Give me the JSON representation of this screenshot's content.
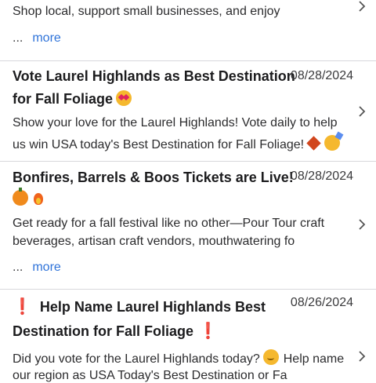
{
  "items": [
    {
      "body_line1": "Shop local, support small businesses, and enjoy",
      "more_dots": "...",
      "more_label": "more"
    },
    {
      "title_line1": "Vote Laurel Highlands as Best Destination",
      "title_line2": "for Fall Foliage",
      "date": "08/28/2024",
      "body_line1": "Show your love for the Laurel Highlands! Vote daily to help",
      "body_line2": "us win USA today's Best Destination for Fall Foliage!"
    },
    {
      "title_line1": "Bonfires, Barrels & Boos Tickets are Live!",
      "date": "08/28/2024",
      "body_line1": "Get ready for a fall festival like no other—Pour Tour craft",
      "body_line2": "beverages, artisan craft vendors, mouthwatering fo",
      "more_dots": "...",
      "more_label": "more"
    },
    {
      "title_line1": "Help Name Laurel Highlands Best",
      "title_line2": "Destination for Fall Foliage",
      "date": "08/26/2024",
      "body_line1_a": "Did you vote for the Laurel Highlands today?",
      "body_line1_b": "Help name",
      "body_line2": "our region as USA Today's Best Destination or Fa"
    }
  ],
  "icons": {
    "chevron": "chevron-right-icon",
    "emoji": [
      "heart-eyes-emoji",
      "maple-leaf-emoji",
      "partying-face-emoji",
      "jack-o-lantern-emoji",
      "fire-emoji",
      "thinking-face-emoji",
      "exclamation-emoji"
    ]
  },
  "colors": {
    "link": "#2f73d9",
    "divider": "#d8d8dc",
    "exclamation": "#e01e2b"
  }
}
